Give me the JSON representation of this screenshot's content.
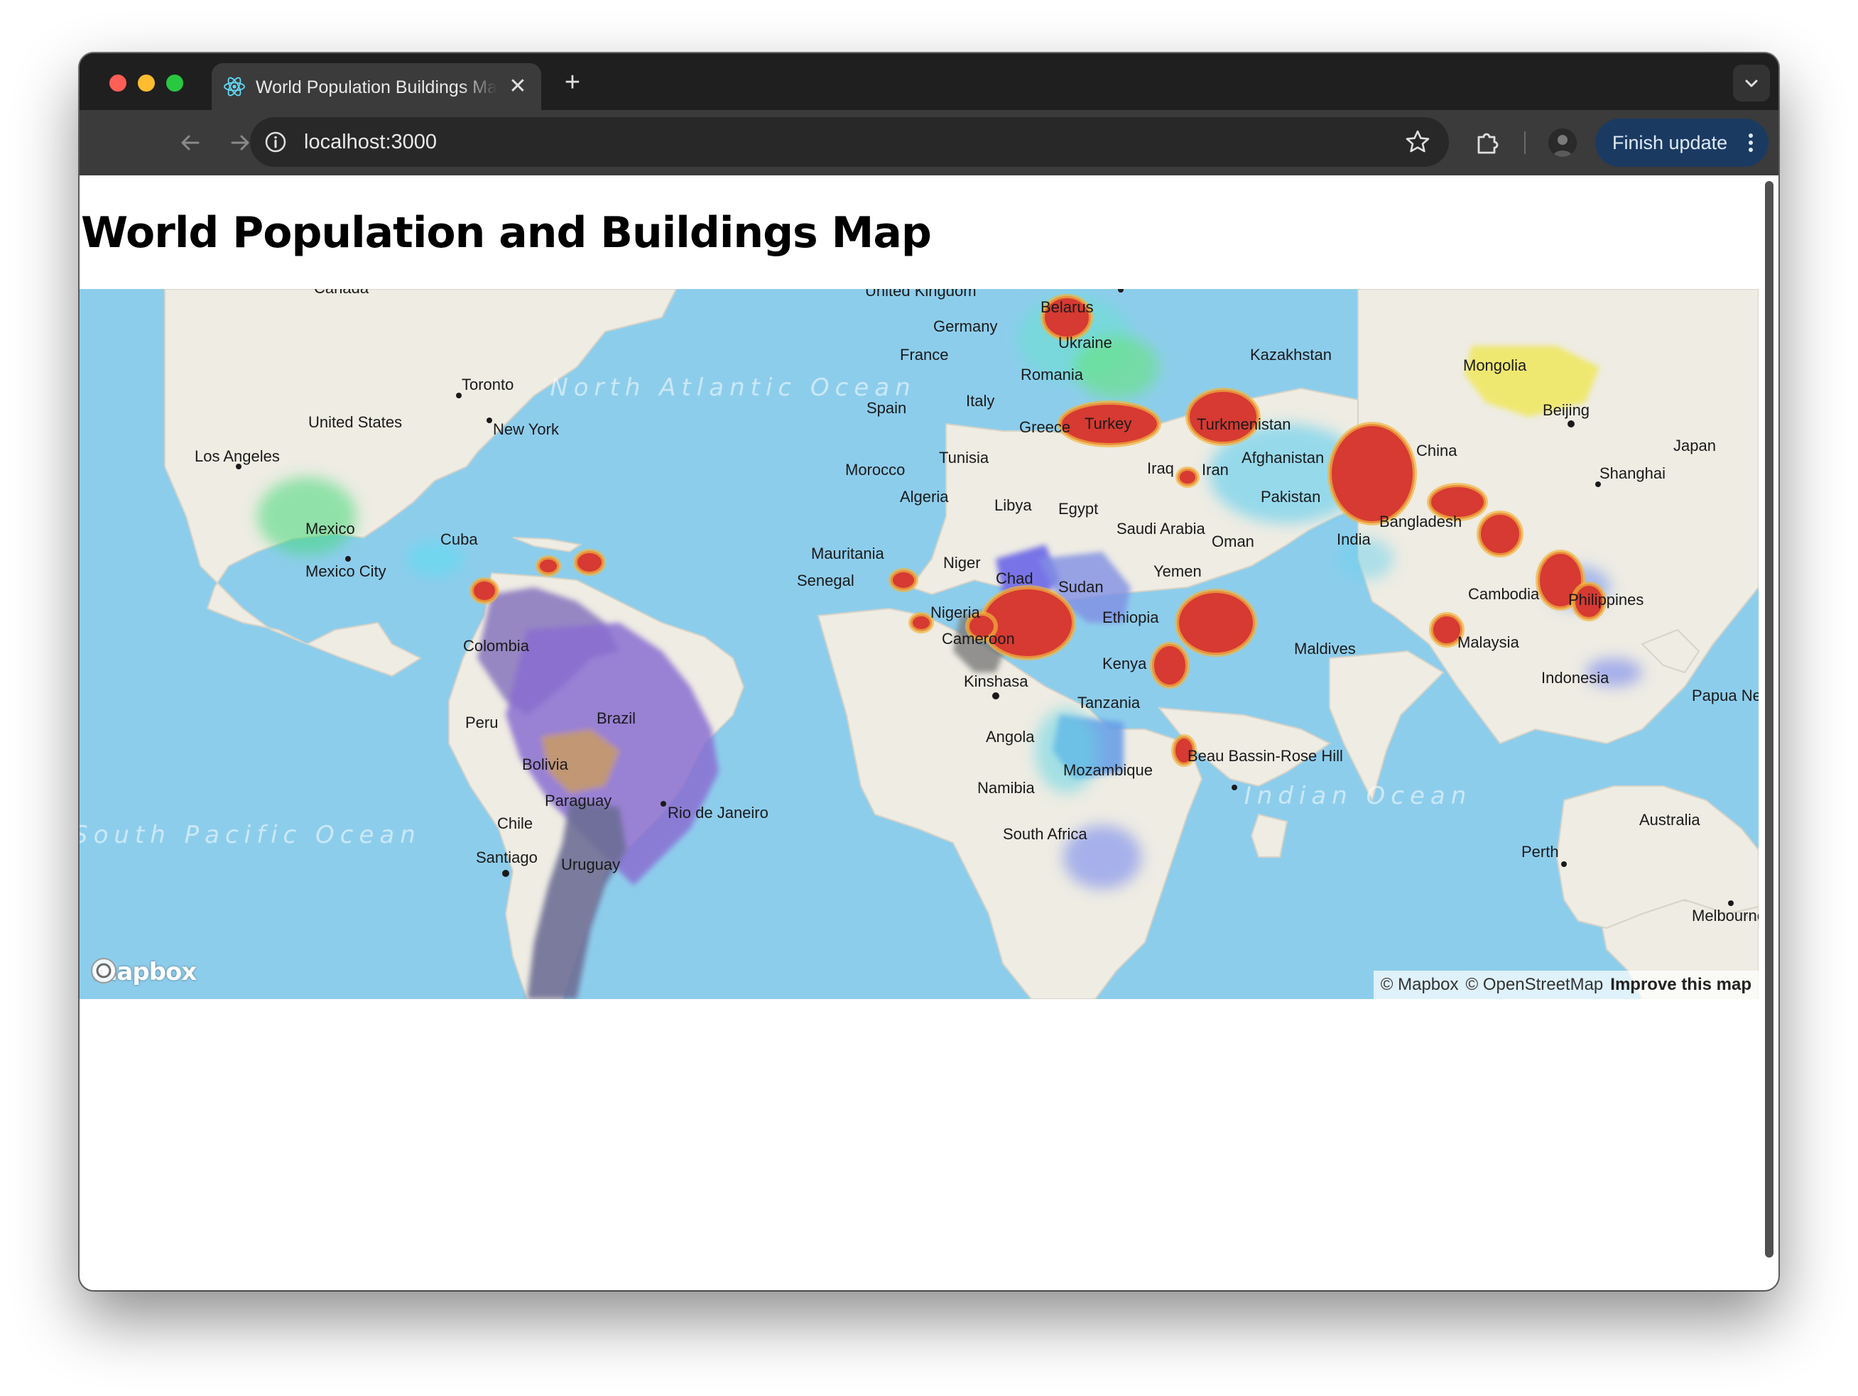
{
  "browser": {
    "tab_title": "World Population Buildings Map",
    "new_tab": "+",
    "url": "localhost:3000",
    "finish_update": "Finish update"
  },
  "page": {
    "title": "World Population and Buildings Map"
  },
  "map": {
    "country_labels": {
      "canada": "Canada",
      "united_states": "United States",
      "mexico": "Mexico",
      "cuba": "Cuba",
      "colombia": "Colombia",
      "peru": "Peru",
      "brazil": "Brazil",
      "bolivia": "Bolivia",
      "paraguay": "Paraguay",
      "chile": "Chile",
      "uruguay": "Uruguay",
      "united_kingdom": "United Kingdom",
      "germany": "Germany",
      "france": "France",
      "spain": "Spain",
      "italy": "Italy",
      "belarus": "Belarus",
      "ukraine": "Ukraine",
      "romania": "Romania",
      "greece": "Greece",
      "turkey": "Turkey",
      "kazakhstan": "Kazakhstan",
      "mongolia": "Mongolia",
      "turkmenistan": "Turkmenistan",
      "iraq": "Iraq",
      "iran": "Iran",
      "afghanistan": "Afghanistan",
      "pakistan": "Pakistan",
      "china": "China",
      "japan": "Japan",
      "india": "India",
      "bangladesh": "Bangladesh",
      "tunisia": "Tunisia",
      "morocco": "Morocco",
      "algeria": "Algeria",
      "libya": "Libya",
      "egypt": "Egypt",
      "saudi_arabia": "Saudi Arabia",
      "oman": "Oman",
      "yemen": "Yemen",
      "mauritania": "Mauritania",
      "senegal": "Senegal",
      "niger": "Niger",
      "chad": "Chad",
      "sudan": "Sudan",
      "nigeria": "Nigeria",
      "cameroon": "Cameroon",
      "ethiopia": "Ethiopia",
      "kenya": "Kenya",
      "tanzania": "Tanzania",
      "angola": "Angola",
      "namibia": "Namibia",
      "mozambique": "Mozambique",
      "south_africa": "South Africa",
      "maldives": "Maldives",
      "malaysia": "Malaysia",
      "cambodia": "Cambodia",
      "philippines": "Philippines",
      "indonesia": "Indonesia",
      "papua_new_guinea": "Papua New Guinea",
      "australia": "Australia"
    },
    "city_labels": {
      "toronto": "Toronto",
      "new_york": "New York",
      "los_angeles": "Los Angeles",
      "mexico_city": "Mexico City",
      "rio": "Rio de Janeiro",
      "santiago": "Santiago",
      "kinshasa": "Kinshasa",
      "beijing": "Beijing",
      "shanghai": "Shanghai",
      "perth": "Perth",
      "melbourne": "Melbourne",
      "beau_bassin": "Beau Bassin-Rose Hill"
    },
    "ocean_labels": {
      "north_atlantic": "North Atlantic Ocean",
      "indian": "Indian Ocean",
      "south_pacific": "South Pacific Ocean"
    },
    "logo": "mapbox",
    "attribution": {
      "mapbox": "© Mapbox",
      "osm": "© OpenStreetMap",
      "improve": "Improve this map"
    },
    "colors": {
      "ocean": "#8dcdec",
      "land": "#f1eee6",
      "heat_high": "#d63a32",
      "heat_mid": "#7fe08a",
      "heat_low": "#7b7ef2"
    }
  }
}
